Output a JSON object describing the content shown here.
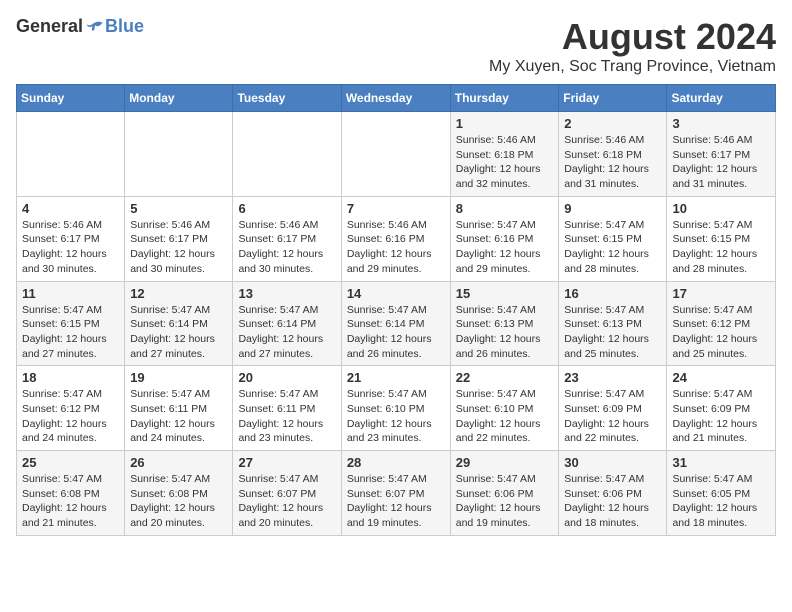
{
  "logo": {
    "general": "General",
    "blue": "Blue"
  },
  "header": {
    "month": "August 2024",
    "location": "My Xuyen, Soc Trang Province, Vietnam"
  },
  "weekdays": [
    "Sunday",
    "Monday",
    "Tuesday",
    "Wednesday",
    "Thursday",
    "Friday",
    "Saturday"
  ],
  "weeks": [
    [
      {
        "day": "",
        "info": ""
      },
      {
        "day": "",
        "info": ""
      },
      {
        "day": "",
        "info": ""
      },
      {
        "day": "",
        "info": ""
      },
      {
        "day": "1",
        "info": "Sunrise: 5:46 AM\nSunset: 6:18 PM\nDaylight: 12 hours\nand 32 minutes."
      },
      {
        "day": "2",
        "info": "Sunrise: 5:46 AM\nSunset: 6:18 PM\nDaylight: 12 hours\nand 31 minutes."
      },
      {
        "day": "3",
        "info": "Sunrise: 5:46 AM\nSunset: 6:17 PM\nDaylight: 12 hours\nand 31 minutes."
      }
    ],
    [
      {
        "day": "4",
        "info": "Sunrise: 5:46 AM\nSunset: 6:17 PM\nDaylight: 12 hours\nand 30 minutes."
      },
      {
        "day": "5",
        "info": "Sunrise: 5:46 AM\nSunset: 6:17 PM\nDaylight: 12 hours\nand 30 minutes."
      },
      {
        "day": "6",
        "info": "Sunrise: 5:46 AM\nSunset: 6:17 PM\nDaylight: 12 hours\nand 30 minutes."
      },
      {
        "day": "7",
        "info": "Sunrise: 5:46 AM\nSunset: 6:16 PM\nDaylight: 12 hours\nand 29 minutes."
      },
      {
        "day": "8",
        "info": "Sunrise: 5:47 AM\nSunset: 6:16 PM\nDaylight: 12 hours\nand 29 minutes."
      },
      {
        "day": "9",
        "info": "Sunrise: 5:47 AM\nSunset: 6:15 PM\nDaylight: 12 hours\nand 28 minutes."
      },
      {
        "day": "10",
        "info": "Sunrise: 5:47 AM\nSunset: 6:15 PM\nDaylight: 12 hours\nand 28 minutes."
      }
    ],
    [
      {
        "day": "11",
        "info": "Sunrise: 5:47 AM\nSunset: 6:15 PM\nDaylight: 12 hours\nand 27 minutes."
      },
      {
        "day": "12",
        "info": "Sunrise: 5:47 AM\nSunset: 6:14 PM\nDaylight: 12 hours\nand 27 minutes."
      },
      {
        "day": "13",
        "info": "Sunrise: 5:47 AM\nSunset: 6:14 PM\nDaylight: 12 hours\nand 27 minutes."
      },
      {
        "day": "14",
        "info": "Sunrise: 5:47 AM\nSunset: 6:14 PM\nDaylight: 12 hours\nand 26 minutes."
      },
      {
        "day": "15",
        "info": "Sunrise: 5:47 AM\nSunset: 6:13 PM\nDaylight: 12 hours\nand 26 minutes."
      },
      {
        "day": "16",
        "info": "Sunrise: 5:47 AM\nSunset: 6:13 PM\nDaylight: 12 hours\nand 25 minutes."
      },
      {
        "day": "17",
        "info": "Sunrise: 5:47 AM\nSunset: 6:12 PM\nDaylight: 12 hours\nand 25 minutes."
      }
    ],
    [
      {
        "day": "18",
        "info": "Sunrise: 5:47 AM\nSunset: 6:12 PM\nDaylight: 12 hours\nand 24 minutes."
      },
      {
        "day": "19",
        "info": "Sunrise: 5:47 AM\nSunset: 6:11 PM\nDaylight: 12 hours\nand 24 minutes."
      },
      {
        "day": "20",
        "info": "Sunrise: 5:47 AM\nSunset: 6:11 PM\nDaylight: 12 hours\nand 23 minutes."
      },
      {
        "day": "21",
        "info": "Sunrise: 5:47 AM\nSunset: 6:10 PM\nDaylight: 12 hours\nand 23 minutes."
      },
      {
        "day": "22",
        "info": "Sunrise: 5:47 AM\nSunset: 6:10 PM\nDaylight: 12 hours\nand 22 minutes."
      },
      {
        "day": "23",
        "info": "Sunrise: 5:47 AM\nSunset: 6:09 PM\nDaylight: 12 hours\nand 22 minutes."
      },
      {
        "day": "24",
        "info": "Sunrise: 5:47 AM\nSunset: 6:09 PM\nDaylight: 12 hours\nand 21 minutes."
      }
    ],
    [
      {
        "day": "25",
        "info": "Sunrise: 5:47 AM\nSunset: 6:08 PM\nDaylight: 12 hours\nand 21 minutes."
      },
      {
        "day": "26",
        "info": "Sunrise: 5:47 AM\nSunset: 6:08 PM\nDaylight: 12 hours\nand 20 minutes."
      },
      {
        "day": "27",
        "info": "Sunrise: 5:47 AM\nSunset: 6:07 PM\nDaylight: 12 hours\nand 20 minutes."
      },
      {
        "day": "28",
        "info": "Sunrise: 5:47 AM\nSunset: 6:07 PM\nDaylight: 12 hours\nand 19 minutes."
      },
      {
        "day": "29",
        "info": "Sunrise: 5:47 AM\nSunset: 6:06 PM\nDaylight: 12 hours\nand 19 minutes."
      },
      {
        "day": "30",
        "info": "Sunrise: 5:47 AM\nSunset: 6:06 PM\nDaylight: 12 hours\nand 18 minutes."
      },
      {
        "day": "31",
        "info": "Sunrise: 5:47 AM\nSunset: 6:05 PM\nDaylight: 12 hours\nand 18 minutes."
      }
    ]
  ]
}
